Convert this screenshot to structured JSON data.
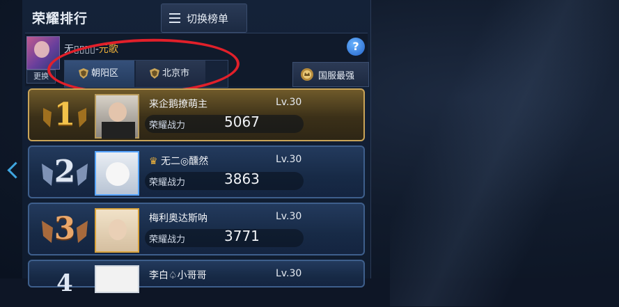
{
  "header": {
    "title": "荣耀排行",
    "switch_label": "切换榜单"
  },
  "me": {
    "name_visible": "无▯▯▯▯-",
    "name_suffix": "元歌",
    "change_label": "更换"
  },
  "region_tabs": [
    {
      "label": "朝阳区",
      "selected": true
    },
    {
      "label": "北京市",
      "selected": false
    }
  ],
  "national_label": "国服最强",
  "help_label": "?",
  "power_label": "荣耀战力",
  "ranking": [
    {
      "rank": "1",
      "name": "来企鹅撩萌主",
      "level": "Lv.30",
      "power": "5067",
      "style": "gold"
    },
    {
      "rank": "2",
      "name": "无二◎醺然",
      "level": "Lv.30",
      "power": "3863",
      "style": "blue"
    },
    {
      "rank": "3",
      "name": "梅利奥达斯呐",
      "level": "Lv.30",
      "power": "3771",
      "style": "blue"
    },
    {
      "rank": "4",
      "name": "李白♤小哥哥",
      "level": "Lv.30",
      "power": "",
      "style": "blue"
    }
  ],
  "colors": {
    "accent_blue": "#3fa6e0",
    "gold_border": "#c9a458",
    "annotation_red": "#e1202a"
  }
}
